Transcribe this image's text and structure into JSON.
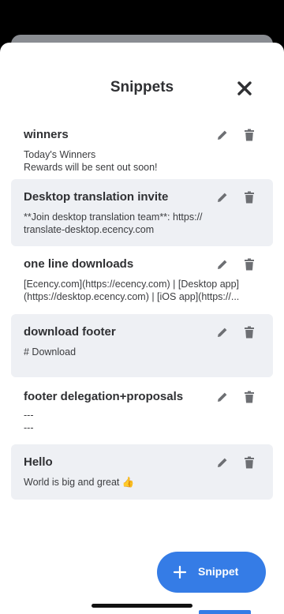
{
  "header": {
    "title": "Snippets",
    "close_icon": "close-icon"
  },
  "snippets": [
    {
      "title": "winners",
      "body": "Today's Winners\nRewards will be sent out soon!"
    },
    {
      "title": "Desktop translation invite",
      "body": "**Join desktop translation team**: https://\ntranslate-desktop.ecency.com"
    },
    {
      "title": "one line downloads",
      "body": "[Ecency.com](https://ecency.com) | [Desktop app](https://desktop.ecency.com) | [iOS app](https://..."
    },
    {
      "title": "download footer",
      "body": "# Download"
    },
    {
      "title": "footer delegation+proposals",
      "body": "---\n---"
    },
    {
      "title": "Hello",
      "body": "World is big and great 👍"
    }
  ],
  "fab": {
    "label": "Snippet"
  },
  "colors": {
    "accent": "#357ce6",
    "alt_row": "#eef0f4",
    "icon": "#6d6f73"
  }
}
